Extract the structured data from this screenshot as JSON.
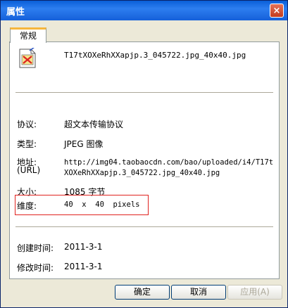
{
  "window": {
    "title": "属性",
    "close_glyph": "×"
  },
  "tabs": [
    {
      "label": "常规"
    }
  ],
  "file": {
    "icon": "broken-image-icon",
    "name": "T17tXOXeRhXXapjp.3_045722.jpg_40x40.jpg"
  },
  "properties": {
    "protocol": {
      "label": "协议:",
      "value": "超文本传输协议"
    },
    "type": {
      "label": "类型:",
      "value": "JPEG 图像"
    },
    "address": {
      "label": "地址:",
      "sublabel": "(URL)",
      "value": "http://img04.taobaocdn.com/bao/uploaded/i4/T17t\nXOXeRhXXapjp.3_045722.jpg_40x40.jpg"
    },
    "size": {
      "label": "大小:",
      "value": "1085 字节"
    },
    "dimensions": {
      "label": "维度:",
      "value": "40  x  40  pixels"
    },
    "created": {
      "label": "创建时间:",
      "value": "2011-3-1"
    },
    "modified": {
      "label": "修改时间:",
      "value": "2011-3-1"
    }
  },
  "buttons": {
    "ok": "确定",
    "cancel": "取消",
    "apply": "应用(A)"
  },
  "colors": {
    "title_bar": "#1560d9",
    "highlight_box": "#e0231f",
    "tab_accent": "#f6b63d"
  }
}
